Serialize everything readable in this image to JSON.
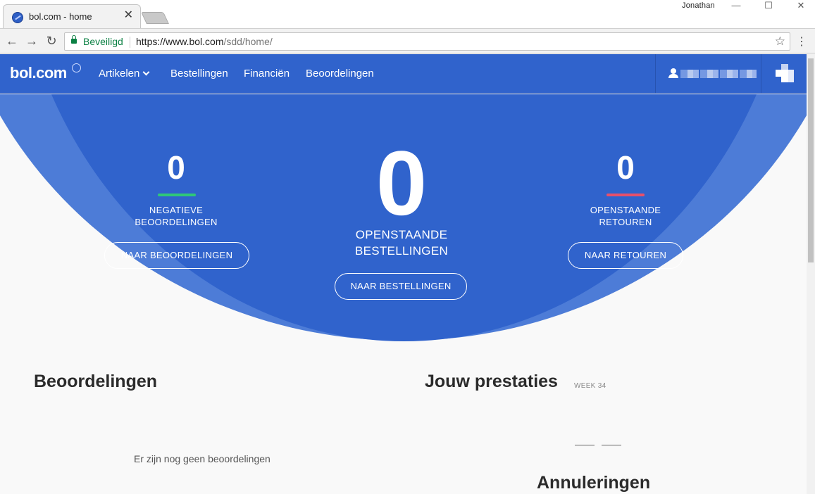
{
  "browser": {
    "tab_title": "bol.com - home",
    "tab_close": "✕",
    "window_user": "Jonathan",
    "window_controls": [
      "—",
      "☐",
      "✕"
    ],
    "nav": {
      "back": "←",
      "forward": "→",
      "reload": "↻"
    },
    "secure_label": "Beveiligd",
    "url_host": "https://www.bol.com",
    "url_path": "/sdd/home/",
    "star_icon": "☆",
    "menu_icon": "⋮"
  },
  "site": {
    "logo": "bol.com",
    "nav_items": [
      "Artikelen",
      "Bestellingen",
      "Financiën",
      "Beoordelingen"
    ]
  },
  "hero": {
    "negative_reviews": {
      "count": "0",
      "label_line1": "NEGATIEVE",
      "label_line2": "BEOORDELINGEN",
      "button": "NAAR BEOORDELINGEN",
      "bar_color": "#2fc878"
    },
    "open_orders": {
      "count": "0",
      "label_line1": "OPENSTAANDE",
      "label_line2": "BESTELLINGEN",
      "button": "NAAR BESTELLINGEN"
    },
    "open_returns": {
      "count": "0",
      "label_line1": "OPENSTAANDE",
      "label_line2": "RETOUREN",
      "button": "NAAR RETOUREN",
      "bar_color": "#e8506a"
    }
  },
  "colors": {
    "brand_blue": "#3063cc",
    "ring_blue": "#4d7cd7"
  },
  "reviews": {
    "title": "Beoordelingen",
    "empty": "Er zijn nog geen beoordelingen"
  },
  "performance": {
    "title": "Jouw prestaties",
    "week": "WEEK 34",
    "sub_title": "Annuleringen"
  }
}
